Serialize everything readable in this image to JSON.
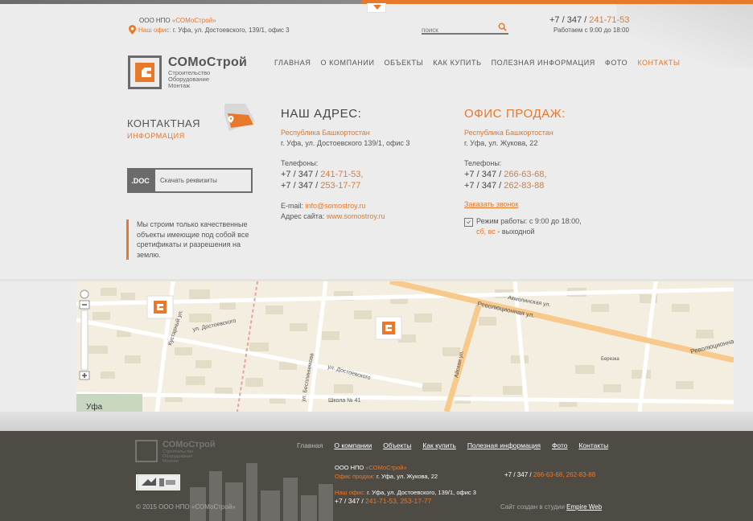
{
  "header": {
    "company_prefix": "ООО НПО ",
    "company_name": "«СОМоСтрой»",
    "office_label": "Наш офис:",
    "office_address": " г. Уфа, ул. Достоевского, 139/1, офис 3",
    "search_placeholder": "поиск",
    "phone_prefix": "+7 / 347 / ",
    "phone_number": "241-71-53",
    "hours": "Работаем с 9:00 до 18:00"
  },
  "logo": {
    "name": "СОМоСтрой",
    "sub1": "Строительство",
    "sub2": "Оборудование",
    "sub3": "Монтаж"
  },
  "nav": [
    "ГЛАВНАЯ",
    "О КОМПАНИИ",
    "ОБЪЕКТЫ",
    "КАК КУПИТЬ",
    "ПОЛЕЗНАЯ ИНФОРМАЦИЯ",
    "ФОТО",
    "КОНТАКТЫ"
  ],
  "contact_section": {
    "title": "КОНТАКТНАЯ",
    "subtitle": "ИНФОРМАЦИЯ",
    "doc_badge": ".DOC",
    "doc_button": "Скачать реквизиты",
    "quote": "Мы строим только качественные объекты имеющие под собой все сретификаты и разрешения на землю."
  },
  "address": {
    "heading": "НАШ АДРЕС:",
    "region": "Республика Башкортостан",
    "street": "г. Уфа, ул. Достоевского 139/1, офис 3",
    "phones_label": "Телефоны:",
    "phone_prefix": "+7 / 347 / ",
    "phone1": "241-71-53,",
    "phone2": "253-17-77",
    "email_label": "E-mail: ",
    "email": "info@somostroy.ru",
    "site_label": "Адрес сайта: ",
    "site": "www.somostroy.ru"
  },
  "sales": {
    "heading": "ОФИС ПРОДАЖ:",
    "region": "Республика Башкортостан",
    "street": "г. Уфа, ул. Жукова, 22",
    "phones_label": "Телефоны:",
    "phone_prefix": "+7 / 347 / ",
    "phone1": "266-63-68,",
    "phone2": "262-83-88",
    "callback": "Заказать звонок",
    "schedule": "Режим работы: с 9:00 до 18:00,",
    "days_off": "сб, вс",
    "days_off_suffix": " - выходной"
  },
  "map": {
    "streets": [
      "ул. Достоевского",
      "ул. Достоевского",
      "Кустарный ул.",
      "Революционная ул.",
      "Революционная",
      "Айская ул.",
      "ул. Бесплинникова",
      "Акмолинская ул.",
      "Школа № 41",
      "Березка",
      "Уфа"
    ]
  },
  "footer": {
    "logo_name": "СОМоСтрой",
    "logo_sub1": "Строительство",
    "logo_sub2": "Оборудование",
    "logo_sub3": "Монтаж",
    "nav": [
      "Главная",
      "О компании",
      "Объекты",
      "Как купить",
      "Полезная информация",
      "Фото",
      "Контакты"
    ],
    "company_prefix": "ООО НПО ",
    "company_name": "«СОМоСтрой»",
    "sales_label": "Офис продаж:",
    "sales_address": " г. Уфа, ул. Жукова, 22",
    "office_label": "Наш офис:",
    "office_address": " г. Уфа, ул. Достоевского, 139/1, офис 3",
    "phone_prefix": "+7 / 347 / ",
    "office_phones": "241-71-53, 253-17-77",
    "sales_phones": "266-63-68, 262-83-88",
    "copyright": "© 2015 ООО НПО «СОМоСтрой»",
    "credit_prefix": "Сайт создан в студии ",
    "credit_link": "Empire Web"
  }
}
